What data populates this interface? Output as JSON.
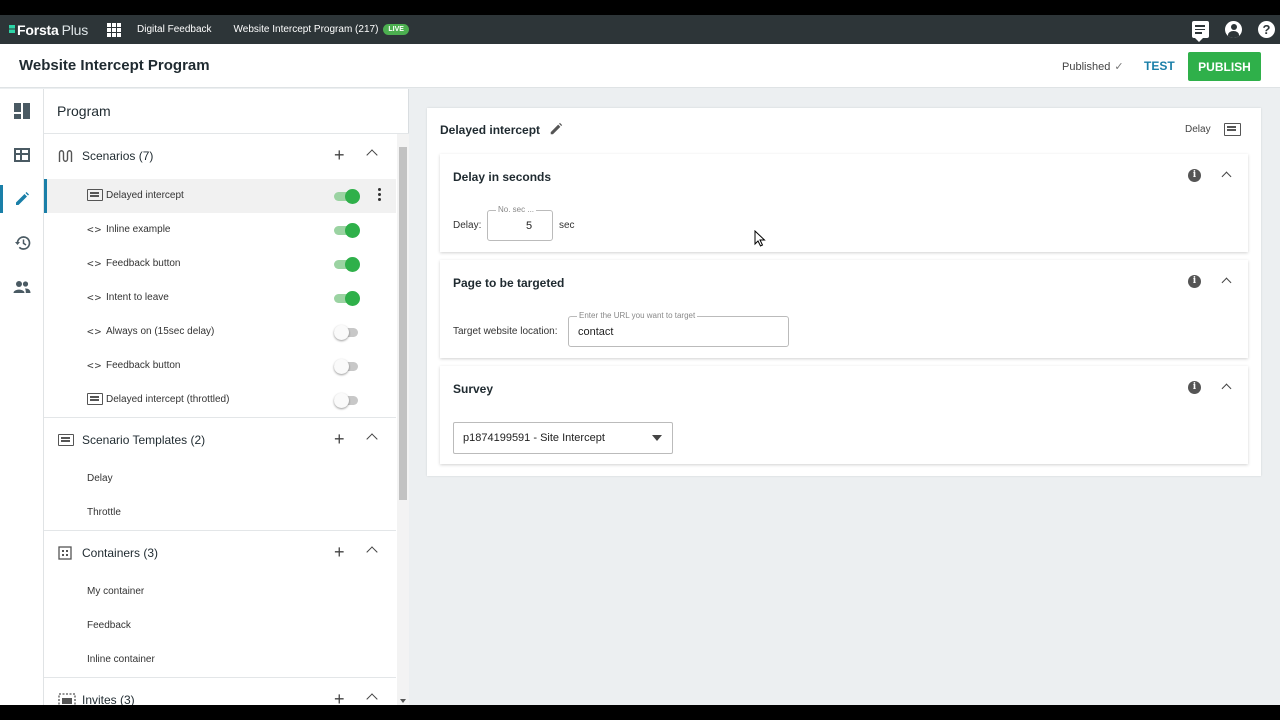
{
  "topbar": {
    "logo_main": "Forsta",
    "logo_plus": "Plus",
    "crumb_digital": "Digital Feedback",
    "crumb_program": "Website Intercept Program (217)",
    "live_badge": "LIVE"
  },
  "header": {
    "title": "Website Intercept Program",
    "status": "Published",
    "test_label": "TEST",
    "publish_label": "PUBLISH"
  },
  "sidebar": {
    "title": "Program",
    "sections": {
      "scenarios": "Scenarios (7)",
      "templates": "Scenario Templates (2)",
      "containers": "Containers (3)",
      "invites": "Invites (3)"
    },
    "scenarios": [
      {
        "label": "Delayed intercept",
        "icon": "form-icon",
        "enabled": true
      },
      {
        "label": "Inline example",
        "icon": "code-icon",
        "enabled": true
      },
      {
        "label": "Feedback button",
        "icon": "code-icon",
        "enabled": true
      },
      {
        "label": "Intent to leave",
        "icon": "code-icon",
        "enabled": true
      },
      {
        "label": "Always on (15sec delay)",
        "icon": "code-icon",
        "enabled": false
      },
      {
        "label": "Feedback button",
        "icon": "code-icon",
        "enabled": false
      },
      {
        "label": "Delayed intercept (throttled)",
        "icon": "form-icon",
        "enabled": false
      }
    ],
    "templates": [
      "Delay",
      "Throttle"
    ],
    "containers": [
      "My container",
      "Feedback",
      "Inline container"
    ]
  },
  "main": {
    "card_title": "Delayed intercept",
    "template_label": "Delay",
    "delay_section": {
      "title": "Delay in seconds",
      "field_label": "Delay:",
      "float_label": "No. sec ...",
      "value": "5",
      "unit": "sec"
    },
    "page_section": {
      "title": "Page to be targeted",
      "field_label": "Target website location:",
      "float_label": "Enter the URL you want to target",
      "value": "contact"
    },
    "survey_section": {
      "title": "Survey",
      "selected": "p1874199591 - Site Intercept"
    }
  },
  "colors": {
    "accent": "#1a7fa8",
    "publish": "#2fb04a",
    "topbar": "#2d3538",
    "toggle_on": "#2fb04a"
  }
}
